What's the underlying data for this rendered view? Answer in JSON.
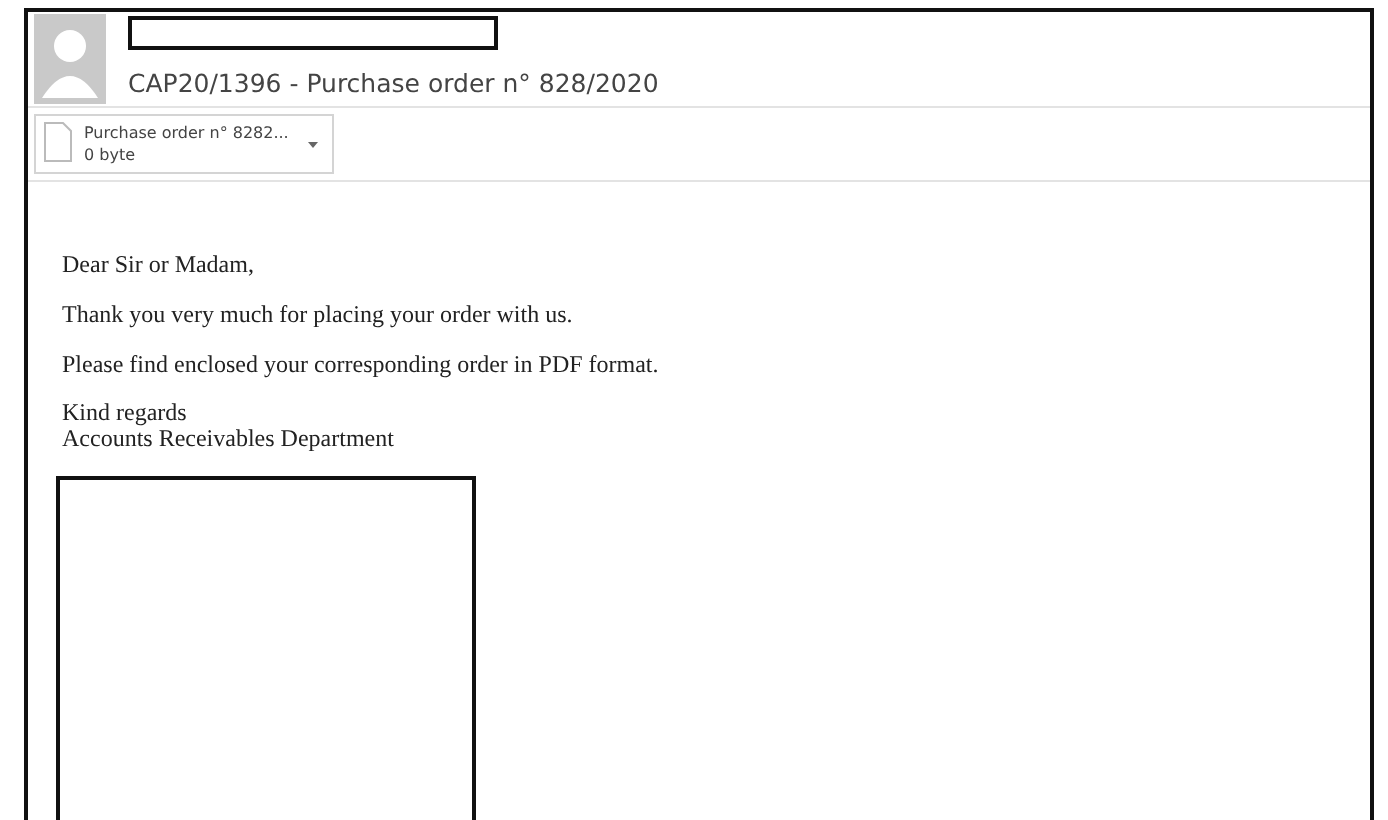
{
  "message": {
    "subject": "CAP20/1396 - Purchase order n° 828/2020"
  },
  "attachments": [
    {
      "name": "Purchase order n° 8282...",
      "size": "0 byte"
    }
  ],
  "body": {
    "paragraphs": [
      "Dear Sir or Madam,",
      "Thank you very much for placing your order with us.",
      "Please find enclosed your corresponding order in PDF format."
    ],
    "signature": [
      "Kind regards",
      "Accounts Receivables Department"
    ]
  }
}
